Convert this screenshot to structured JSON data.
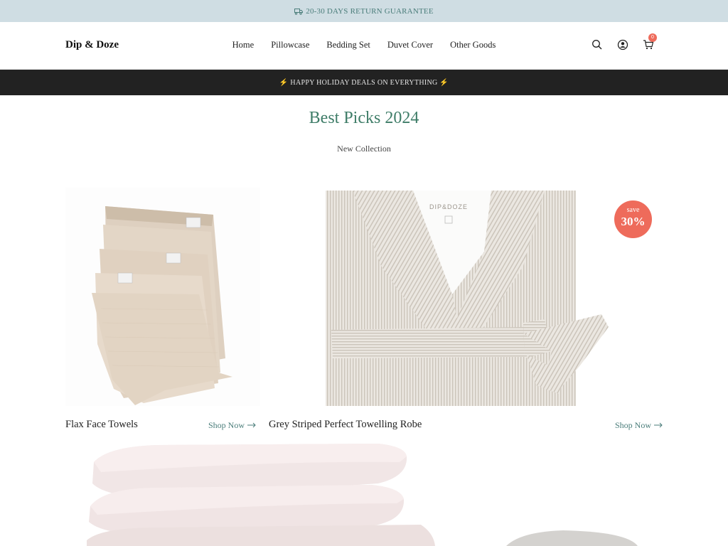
{
  "topbar": {
    "text": "20-30 DAYS RETURN GUARANTEE",
    "icon": "truck-icon"
  },
  "header": {
    "logo": "Dip & Doze",
    "nav": [
      {
        "label": "Home"
      },
      {
        "label": "Pillowcase"
      },
      {
        "label": "Bedding Set"
      },
      {
        "label": "Duvet Cover"
      },
      {
        "label": "Other Goods"
      }
    ],
    "icons": [
      "search-icon",
      "account-icon",
      "cart-icon"
    ],
    "cart_count": "0"
  },
  "promo": {
    "text": "⚡ HAPPY HOLIDAY DEALS ON EVERYTHING ⚡"
  },
  "section": {
    "title": "Best Picks 2024",
    "subtitle": "New Collection"
  },
  "products": [
    {
      "name": "Flax Face Towels",
      "cta": "Shop Now"
    },
    {
      "name": "Grey Striped Perfect Towelling Robe",
      "cta": "Shop Now",
      "badge_label": "save",
      "badge_value": "30%"
    }
  ],
  "robe_label": {
    "brand": "DIP&DOZE"
  },
  "colors": {
    "topbar_bg": "#cfdde3",
    "accent": "#3f7d68",
    "link": "#4a7d7a",
    "badge": "#ee6b5b",
    "promo_bg": "#222222"
  }
}
